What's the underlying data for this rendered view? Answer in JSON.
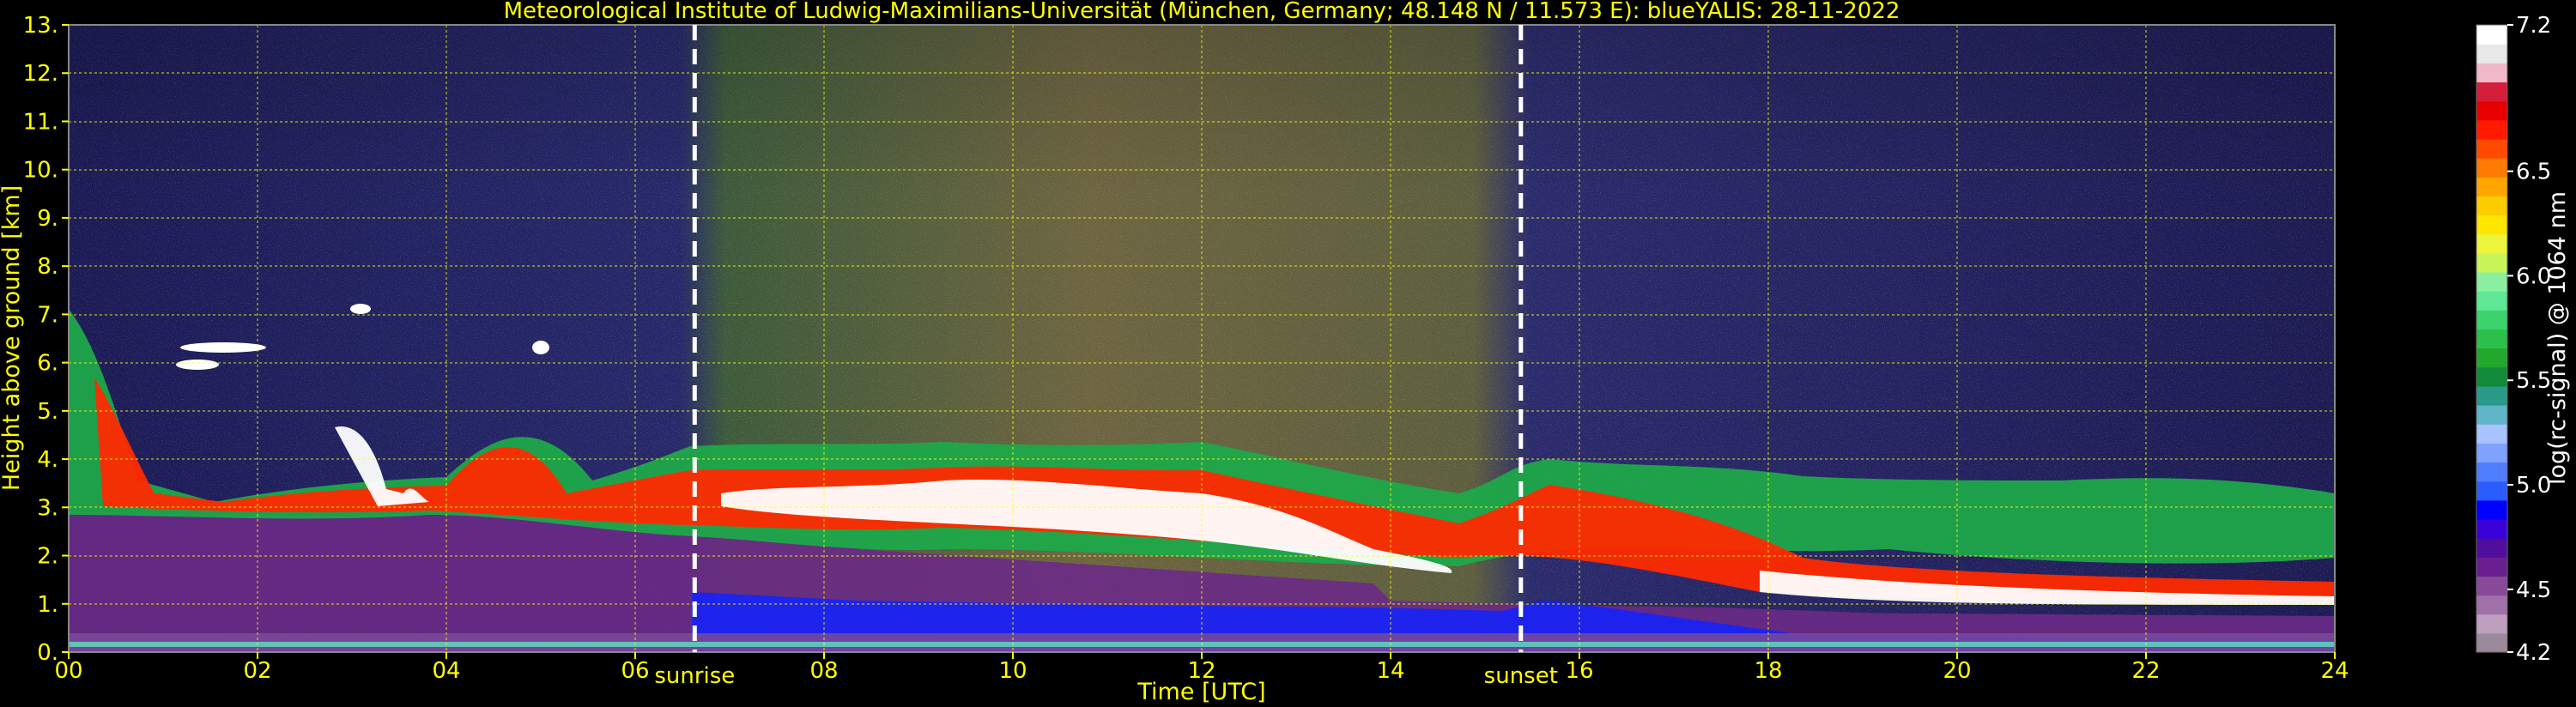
{
  "chart_data": {
    "type": "heatmap",
    "title": "Meteorological Institute of Ludwig-Maximilians-Universität (München, Germany; 48.148 N / 11.573 E):    blueYALIS: 28-11-2022",
    "xlabel": "Time [UTC]",
    "ylabel": "Height above ground [km]",
    "xlim": [
      0,
      24
    ],
    "ylim": [
      0,
      13
    ],
    "x_ticks": [
      "00",
      "02",
      "04",
      "06",
      "08",
      "10",
      "12",
      "14",
      "16",
      "18",
      "20",
      "22",
      "24"
    ],
    "y_ticks": [
      "0.",
      "1.",
      "2.",
      "3.",
      "4.",
      "5.",
      "6.",
      "7.",
      "8.",
      "9.",
      "10.",
      "11.",
      "12.",
      "13."
    ],
    "grid": true,
    "annotations": [
      {
        "label": "sunrise",
        "x": 6.63
      },
      {
        "label": "sunset",
        "x": 15.38
      }
    ],
    "colorbar": {
      "label": "log(rc-signal) @ 1064 nm",
      "range": [
        4.2,
        7.2
      ],
      "tick_values": [
        4.2,
        4.5,
        5.0,
        5.5,
        6.0,
        6.5,
        7.2
      ],
      "tick_labels": [
        "4.2",
        "4.5",
        "5.0",
        "5.5",
        "6.0",
        "6.5",
        "7.2"
      ],
      "colors": [
        "#9b8a9b",
        "#bf9fbf",
        "#a070a8",
        "#884a98",
        "#6a1f90",
        "#4f0e9c",
        "#3a00d8",
        "#0000ff",
        "#2a5cff",
        "#4f7dff",
        "#7fa2ff",
        "#a8c3ff",
        "#5fb6c8",
        "#2a9a8a",
        "#118a3a",
        "#22a82a",
        "#2bc04a",
        "#3cd26e",
        "#5ee896",
        "#8af0a0",
        "#c9f55a",
        "#ecf53c",
        "#ffe600",
        "#ffcc00",
        "#ffa600",
        "#ff7a00",
        "#ff4a00",
        "#ff1a00",
        "#e80000",
        "#d41e3a",
        "#f0b8c8",
        "#e8e8e8",
        "#ffffff"
      ]
    }
  }
}
